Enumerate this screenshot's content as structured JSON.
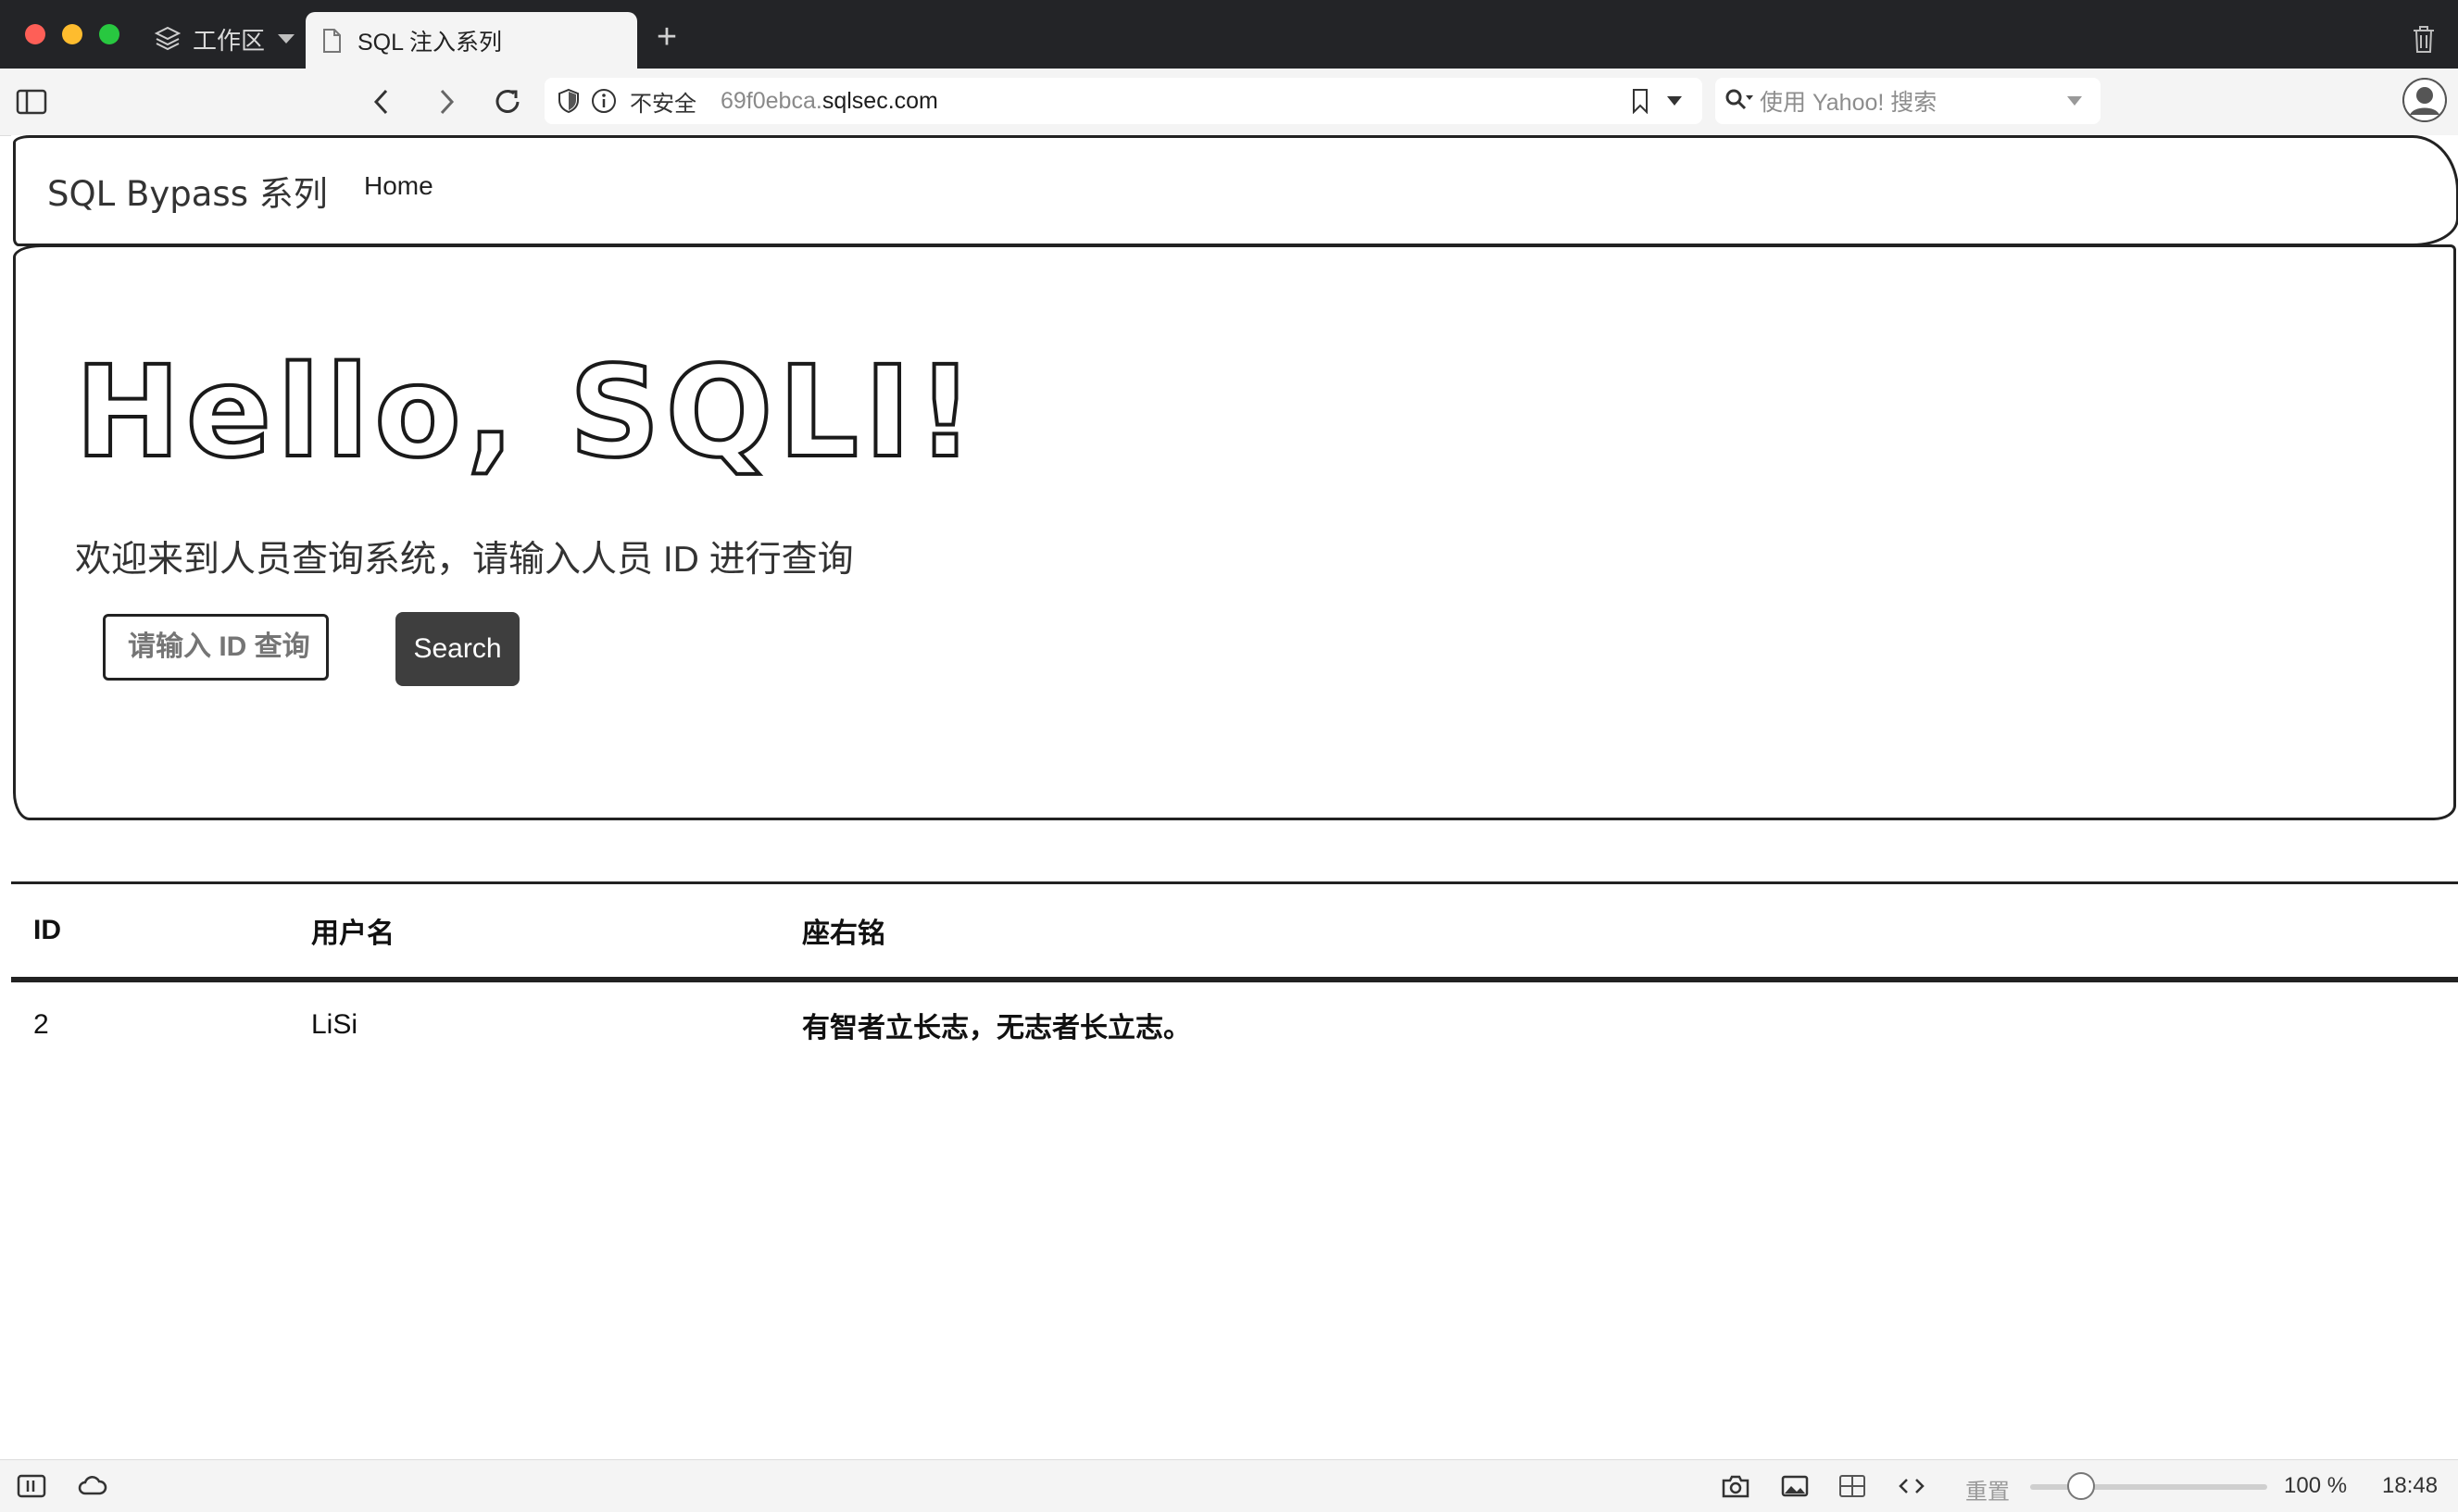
{
  "browser": {
    "workspace_label": "工作区",
    "tab_title": "SQL 注入系列",
    "url_security_label": "不安全",
    "url_subdomain": "69f0ebca.",
    "url_domain": "sqlsec.com",
    "search_placeholder": "使用 Yahoo! 搜索"
  },
  "page": {
    "brand": "SQL Bypass 系列",
    "nav_home": "Home",
    "hero_title": "Hello, SQLI!",
    "subtitle": "欢迎来到人员查询系统，请输入人员 ID 进行查询",
    "search_input_placeholder": "请输入 ID 查询",
    "search_button_label": "Search",
    "table": {
      "headers": [
        "ID",
        "用户名",
        "座右铭"
      ],
      "rows": [
        [
          "2",
          "LiSi",
          "有智者立长志，无志者长立志。"
        ]
      ]
    }
  },
  "statusbar": {
    "reset_label": "重置",
    "zoom_level": "100 %",
    "zoom_fraction": 0.2,
    "clock": "18:48"
  }
}
